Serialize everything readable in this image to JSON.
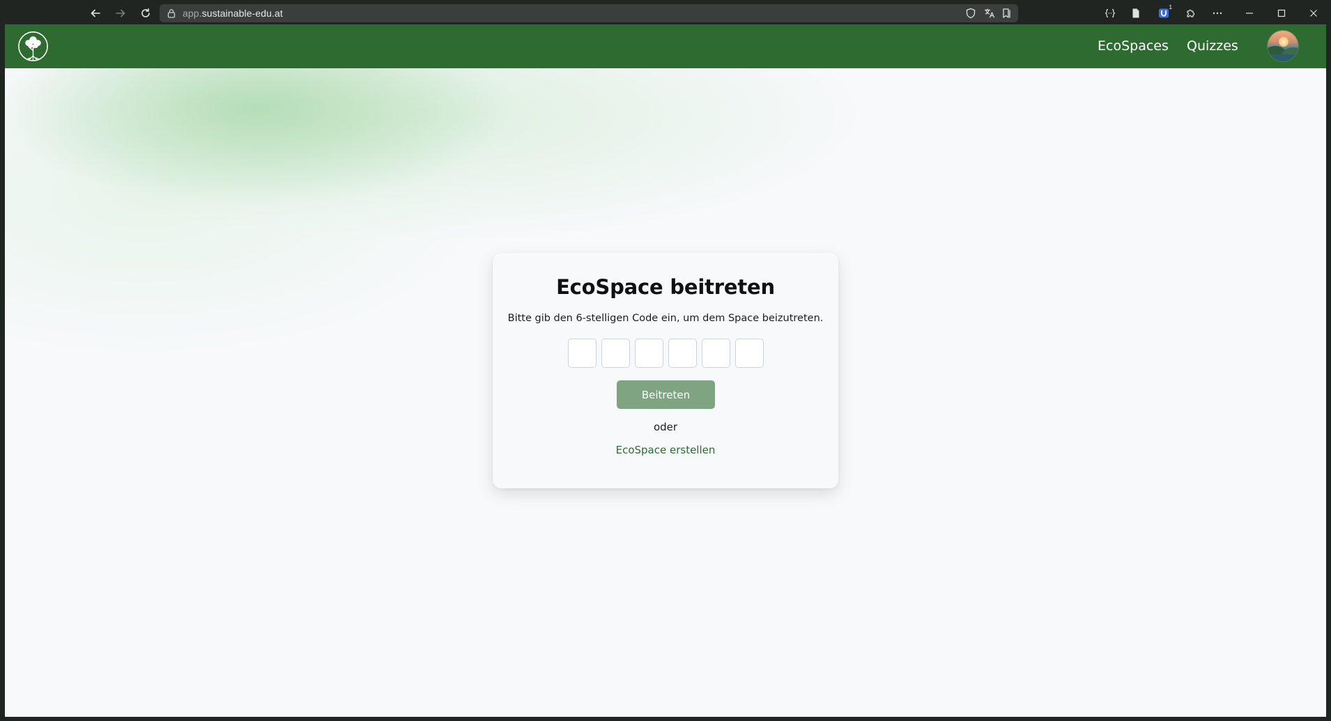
{
  "browser": {
    "url_sub": "app.",
    "url_domain": "sustainable-edu.at",
    "extension_badge": "1",
    "icons": [
      "back-arrow-icon",
      "forward-arrow-icon",
      "reload-icon",
      "lock-icon",
      "shield-icon",
      "translate-icon",
      "reading-list-icon",
      "braces-icon",
      "document-icon",
      "extension-u-icon",
      "puzzle-icon",
      "more-icon",
      "minimize-icon",
      "maximize-icon",
      "close-icon"
    ]
  },
  "header": {
    "background": "#2e6b30",
    "nav": {
      "ecospaces": "EcoSpaces",
      "quizzes": "Quizzes"
    }
  },
  "card": {
    "title": "EcoSpace beitreten",
    "description": "Bitte gib den 6-stelligen Code ein, um dem Space beizutreten.",
    "code_digits": [
      "",
      "",
      "",
      "",
      "",
      ""
    ],
    "join_button": "Beitreten",
    "or_text": "oder",
    "create_link": "EcoSpace erstellen"
  },
  "colors": {
    "primary": "#2e6b30",
    "button_disabled": "#7fa482",
    "page_bg": "#f7f9fb"
  }
}
